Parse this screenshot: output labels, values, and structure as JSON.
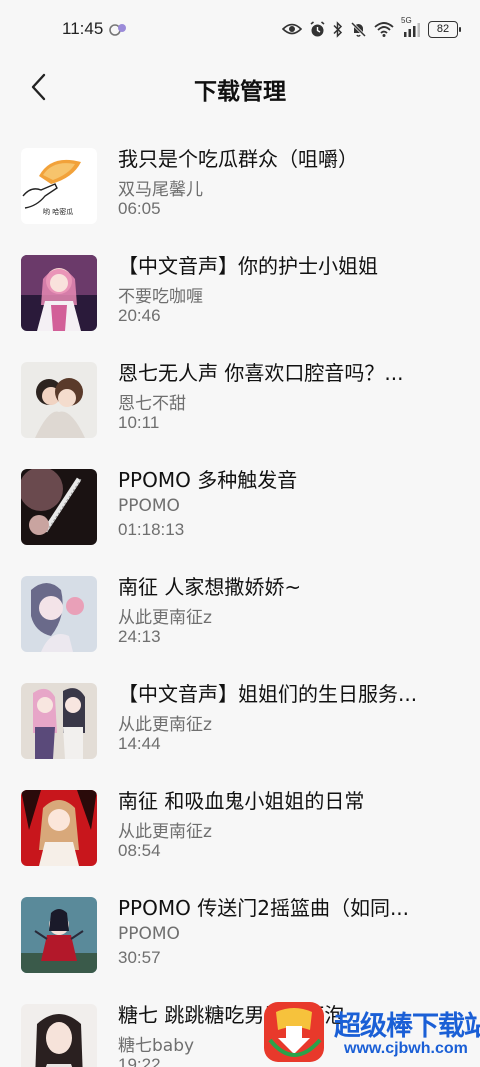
{
  "status_bar": {
    "time": "11:45",
    "network_label": "5G",
    "battery": "82"
  },
  "header": {
    "title": "下载管理"
  },
  "downloads": [
    {
      "title": "我只是个吃瓜群众（咀嚼）",
      "author": "双马尾馨儿",
      "duration": "06:05",
      "thumb_caption": "哟 哈密瓜"
    },
    {
      "title": "【中文音声】你的护士小姐姐",
      "author": "不要吃咖喱",
      "duration": "20:46"
    },
    {
      "title": "恩七无人声 你喜欢口腔音吗？...",
      "author": "恩七不甜",
      "duration": "10:11"
    },
    {
      "title": "PPOMO 多种触发音",
      "author": "PPOMO",
      "duration": "01:18:13"
    },
    {
      "title": "南征 人家想撒娇娇~",
      "author": "从此更南征z",
      "duration": "24:13"
    },
    {
      "title": "【中文音声】姐姐们的生日服务...",
      "author": "从此更南征z",
      "duration": "14:44"
    },
    {
      "title": "南征 和吸血鬼小姐姐的日常",
      "author": "从此更南征z",
      "duration": "08:54"
    },
    {
      "title": "PPOMO 传送门2摇篮曲（如同...",
      "author": "PPOMO",
      "duration": "30:57"
    },
    {
      "title": "糖七 跳跳糖吃男朋友耳泡",
      "author": "糖七baby",
      "duration": "19:22"
    }
  ],
  "watermark": {
    "name": "超级棒下载站",
    "url": "www.cjbwh.com"
  },
  "colors": {
    "background": "#f7f7f7",
    "secondary_text": "#6f6f6f",
    "watermark_blue": "#1a5fd6"
  }
}
